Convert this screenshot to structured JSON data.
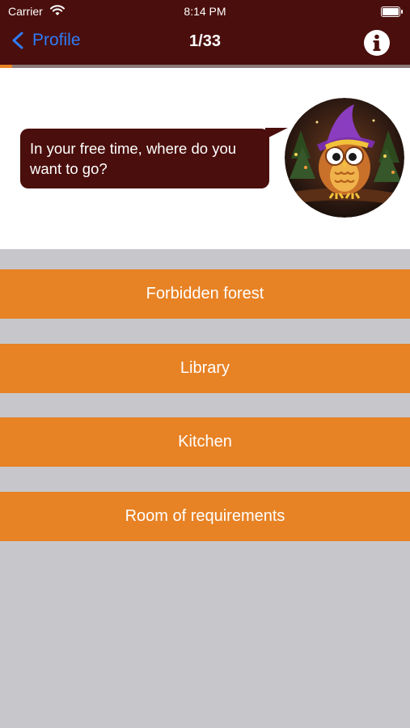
{
  "status_bar": {
    "carrier": "Carrier",
    "time": "8:14 PM"
  },
  "nav": {
    "back_label": "Profile",
    "title": "1/33"
  },
  "progress": {
    "current": 1,
    "total": 33
  },
  "question": {
    "text": "In your free time, where do you want to go?"
  },
  "answers": [
    {
      "label": "Forbidden forest"
    },
    {
      "label": "Library"
    },
    {
      "label": "Kitchen"
    },
    {
      "label": "Room of requirements"
    }
  ],
  "colors": {
    "header": "#4a0e0c",
    "accent": "#e78225",
    "link": "#2f7cf6",
    "background": "#c7c7cb"
  },
  "icons": {
    "back": "chevron-left-icon",
    "info": "info-icon",
    "wifi": "wifi-icon",
    "battery": "battery-icon"
  }
}
